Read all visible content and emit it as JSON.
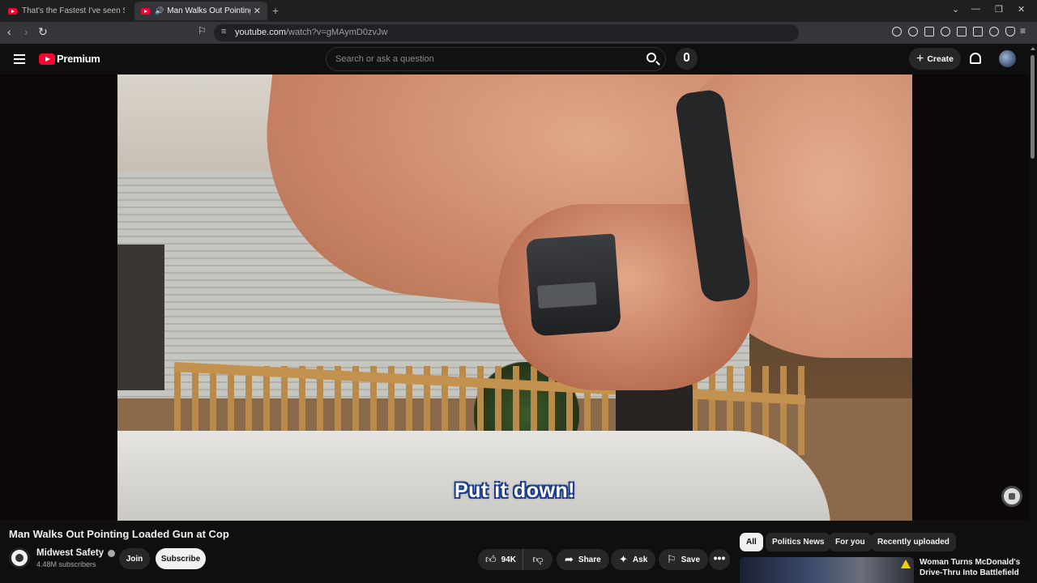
{
  "browser": {
    "tabs": [
      {
        "title": "That's the Fastest I've seen Someone",
        "active": false
      },
      {
        "title": "Man Walks Out Pointing Load",
        "active": true,
        "audio": "🔊"
      }
    ],
    "new_tab": "+",
    "close_glyph": "✕",
    "url_host": "youtube.com",
    "url_path": "/watch?v=gMAymD0zvJw",
    "window_controls": [
      "⌄",
      "—",
      "❐",
      "✕"
    ]
  },
  "masthead": {
    "logo_text": "Premium",
    "search_placeholder": "Search or ask a question",
    "create_label": "Create"
  },
  "video": {
    "caption": "Put it down!"
  },
  "watch": {
    "title": "Man Walks Out Pointing Loaded Gun at Cop",
    "channel_name": "Midwest Safety",
    "subscribers": "4.48M subscribers",
    "join_label": "Join",
    "subscribe_label": "Subscribe",
    "like_count": "94K",
    "share_label": "Share",
    "ask_label": "Ask",
    "save_label": "Save",
    "more_glyph": "•••"
  },
  "chips": [
    "All",
    "Politics News",
    "For you",
    "Recently uploaded"
  ],
  "recommendation": {
    "title": "Woman Turns McDonald's Drive-Thru Into Battlefield"
  },
  "colors": {
    "background": "#0f0f0f",
    "brand_red": "#ff0033",
    "caption_outline": "#1d3c8c"
  }
}
